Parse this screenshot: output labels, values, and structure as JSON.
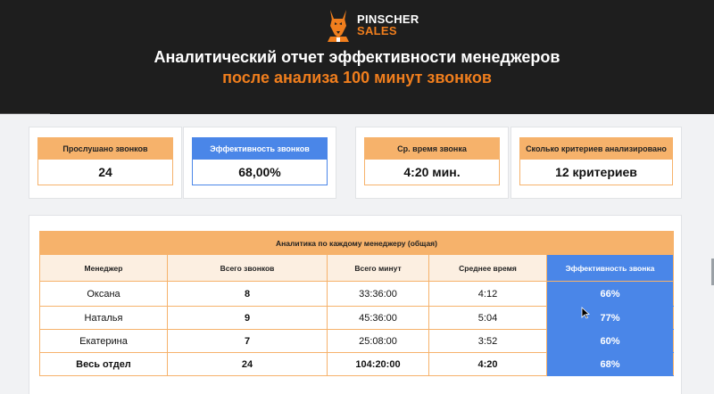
{
  "header": {
    "logo_line1": "PINSCHER",
    "logo_line2": "SALES",
    "title": "Аналитический отчет эффективности менеджеров",
    "subtitle": "после анализа 100 минут звонков"
  },
  "kpis": [
    {
      "label": "Прослушано звонков",
      "value": "24"
    },
    {
      "label": "Эффективность звонков",
      "value": "68,00%"
    },
    {
      "label": "Ср. время звонка",
      "value": "4:20 мин."
    },
    {
      "label": "Сколько критериев анализировано",
      "value": "12 критериев"
    }
  ],
  "table": {
    "title": "Аналитика по каждому менеджеру (общая)",
    "columns": [
      "Менеджер",
      "Всего звонков",
      "Всего минут",
      "Среднее время",
      "Эффективность звонка"
    ],
    "rows": [
      [
        "Оксана",
        "8",
        "33:36:00",
        "4:12",
        "66%"
      ],
      [
        "Наталья",
        "9",
        "45:36:00",
        "5:04",
        "77%"
      ],
      [
        "Екатерина",
        "7",
        "25:08:00",
        "3:52",
        "60%"
      ]
    ],
    "total": [
      "Весь отдел",
      "24",
      "104:20:00",
      "4:20",
      "68%"
    ]
  },
  "colors": {
    "header_bg": "#1e1e1e",
    "accent_orange": "#f07e1d",
    "table_orange": "#f6b26b",
    "highlight_blue": "#4a86e8"
  }
}
